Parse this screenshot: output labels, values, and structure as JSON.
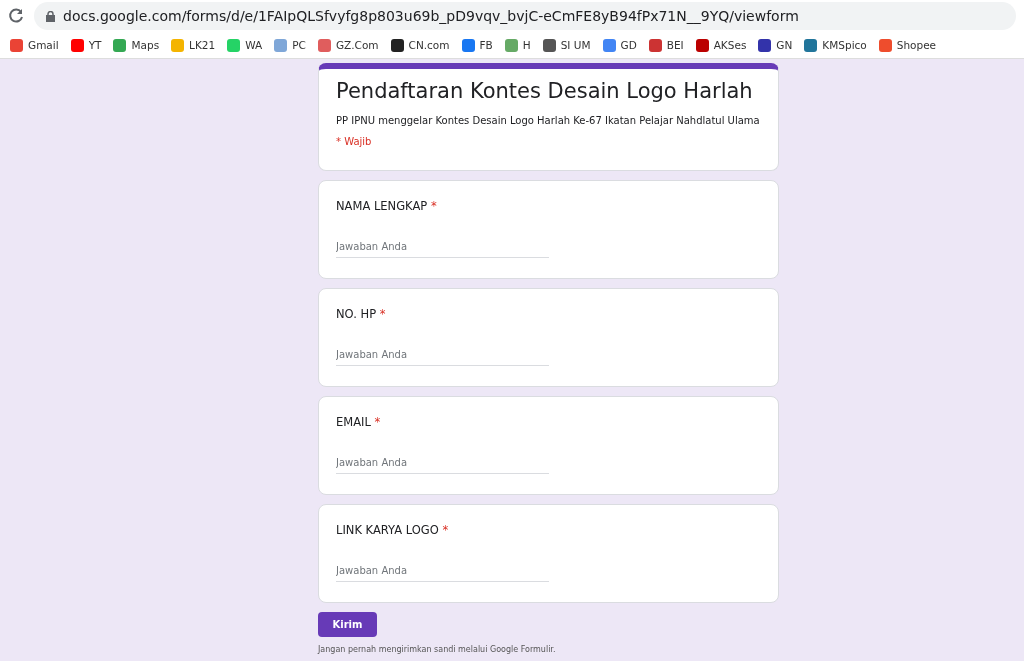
{
  "browser": {
    "url": "docs.google.com/forms/d/e/1FAIpQLSfvyfg8p803u69b_pD9vqv_bvjC-eCmFE8yB94fPx71N__9YQ/viewform",
    "bookmarks": [
      "Gmail",
      "YT",
      "Maps",
      "LK21",
      "WA",
      "PC",
      "GZ.Com",
      "CN.com",
      "FB",
      "H",
      "SI UM",
      "GD",
      "BEI",
      "AKSes",
      "GN",
      "KMSpico",
      "Shopee"
    ]
  },
  "form": {
    "title": "Pendaftaran Kontes Desain Logo Harlah",
    "description": "PP IPNU menggelar Kontes Desain Logo Harlah Ke-67 Ikatan Pelajar Nahdlatul Ulama",
    "required_note": "* Wajib",
    "questions": [
      {
        "label": "NAMA LENGKAP",
        "required_mark": "*",
        "placeholder": "Jawaban Anda"
      },
      {
        "label": "NO. HP",
        "required_mark": "*",
        "placeholder": "Jawaban Anda"
      },
      {
        "label": "EMAIL",
        "required_mark": "*",
        "placeholder": "Jawaban Anda"
      },
      {
        "label": "LINK KARYA LOGO",
        "required_mark": "*",
        "placeholder": "Jawaban Anda"
      }
    ],
    "submit": "Kirim",
    "footer": "Jangan pernah mengirimkan sandi melalui Google Formulir."
  }
}
